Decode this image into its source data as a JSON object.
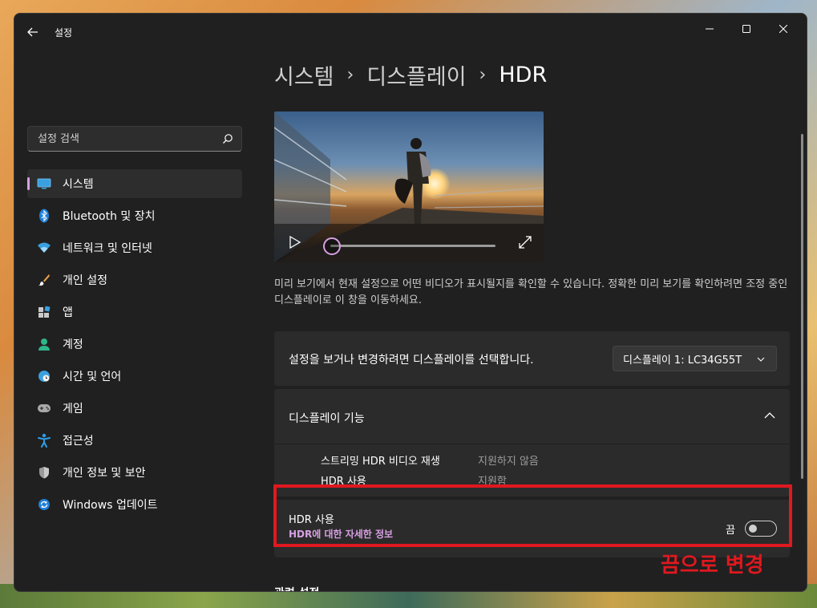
{
  "window": {
    "app_title": "설정"
  },
  "sidebar": {
    "search_placeholder": "설정 검색",
    "items": [
      {
        "label": "시스템",
        "icon": "monitor-icon",
        "selected": true
      },
      {
        "label": "Bluetooth 및 장치",
        "icon": "bluetooth-icon"
      },
      {
        "label": "네트워크 및 인터넷",
        "icon": "wifi-icon"
      },
      {
        "label": "개인 설정",
        "icon": "paintbrush-icon"
      },
      {
        "label": "앱",
        "icon": "apps-icon"
      },
      {
        "label": "계정",
        "icon": "person-icon"
      },
      {
        "label": "시간 및 언어",
        "icon": "globe-clock-icon"
      },
      {
        "label": "게임",
        "icon": "gamepad-icon"
      },
      {
        "label": "접근성",
        "icon": "accessibility-icon"
      },
      {
        "label": "개인 정보 및 보안",
        "icon": "shield-icon"
      },
      {
        "label": "Windows 업데이트",
        "icon": "update-icon"
      }
    ]
  },
  "main": {
    "breadcrumb": [
      "시스템",
      "디스플레이",
      "HDR"
    ],
    "breadcrumb_separator": "›",
    "video": {
      "progress": 0
    },
    "description": "미리 보기에서 현재 설정으로 어떤 비디오가 표시될지를 확인할 수 있습니다. 정확한 미리 보기를 확인하려면 조정 중인 디스플레이로 이 창을 이동하세요.",
    "display_select": {
      "label": "설정을 보거나 변경하려면 디스플레이를 선택합니다.",
      "value": "디스플레이 1: LC34G55T"
    },
    "display_features": {
      "title": "디스플레이 기능",
      "rows": [
        {
          "name": "스트리밍 HDR 비디오 재생",
          "value": "지원하지 않음"
        },
        {
          "name": "HDR 사용",
          "value": "지원함"
        }
      ]
    },
    "hdr_toggle": {
      "title": "HDR 사용",
      "link": "HDR에 대한 자세한 정보",
      "state_label": "끔",
      "on": false
    },
    "related_settings": "관련 설정"
  },
  "annotation": {
    "text": "끔으로 변경",
    "color": "#e0181f"
  },
  "colors": {
    "accent": "#d7a0e3",
    "window_bg": "#202020",
    "card_bg": "#2b2b2b"
  }
}
